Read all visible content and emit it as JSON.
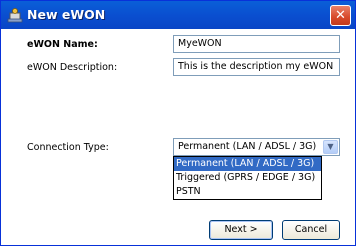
{
  "window": {
    "title": "New eWON",
    "close_symbol": "✕"
  },
  "form": {
    "name_label": "eWON Name:",
    "name_value": "MyeWON",
    "description_label": "eWON Description:",
    "description_value": "This is the description my eWON",
    "connection_label": "Connection Type:",
    "connection_selected": "Permanent (LAN / ADSL / 3G)",
    "connection_options": [
      "Permanent (LAN / ADSL / 3G)",
      "Triggered (GPRS / EDGE / 3G)",
      "PSTN"
    ]
  },
  "buttons": {
    "next_label": "Next >",
    "cancel_label": "Cancel"
  },
  "colors": {
    "titlebar": "#0a5fd8",
    "selection": "#316ac5"
  }
}
